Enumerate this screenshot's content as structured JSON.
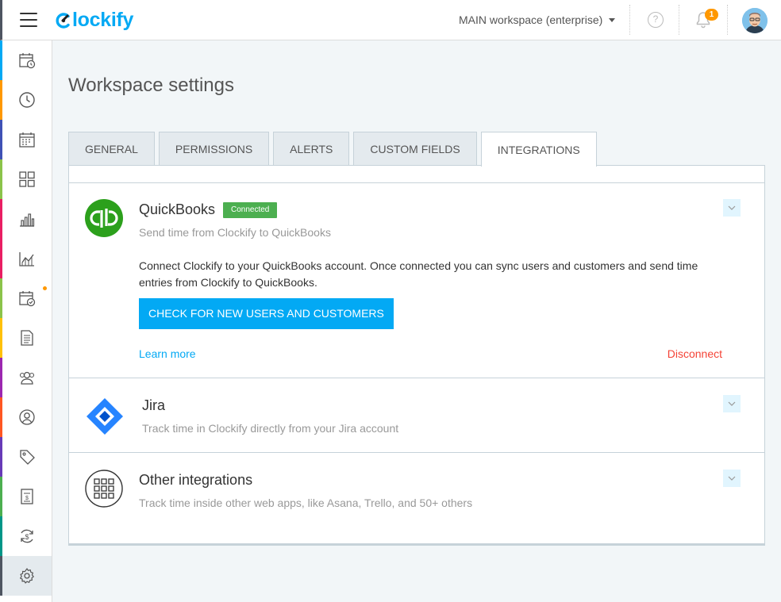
{
  "app": {
    "logo_text": "lockify",
    "brand_color": "#03a9f4"
  },
  "header": {
    "workspace_label": "MAIN workspace (enterprise)",
    "help_icon": "?",
    "notifications_count": "1"
  },
  "sidebar": {
    "items": [
      {
        "name": "timesheet",
        "icon": "calendar-clock-icon",
        "color": "#03a9f4"
      },
      {
        "name": "time-tracker",
        "icon": "clock-icon",
        "color": "#ff9800"
      },
      {
        "name": "calendar",
        "icon": "calendar-icon",
        "color": "#3f51b5"
      },
      {
        "name": "dashboard",
        "icon": "dashboard-grid-icon",
        "color": "#8bc34a"
      },
      {
        "name": "reports",
        "icon": "bar-chart-icon",
        "color": "#e91e63"
      },
      {
        "name": "activity",
        "icon": "area-chart-icon",
        "color": "#e91e63"
      },
      {
        "name": "approvals",
        "icon": "calendar-check-icon",
        "color": "#8bc34a"
      },
      {
        "name": "projects",
        "icon": "document-icon",
        "color": "#ffc107"
      },
      {
        "name": "team",
        "icon": "team-icon",
        "color": "#9c27b0"
      },
      {
        "name": "clients",
        "icon": "person-circle-icon",
        "color": "#ff5722"
      },
      {
        "name": "tags",
        "icon": "tag-icon",
        "color": "#673ab7"
      },
      {
        "name": "invoices",
        "icon": "invoice-icon",
        "color": "#4caf50"
      },
      {
        "name": "expenses",
        "icon": "dollar-sync-icon",
        "color": "#009688"
      },
      {
        "name": "settings",
        "icon": "gear-icon",
        "color": "#4e5561"
      }
    ]
  },
  "page": {
    "title": "Workspace settings"
  },
  "tabs": [
    {
      "label": "GENERAL"
    },
    {
      "label": "PERMISSIONS"
    },
    {
      "label": "ALERTS"
    },
    {
      "label": "CUSTOM FIELDS"
    },
    {
      "label": "INTEGRATIONS"
    }
  ],
  "integrations": {
    "quickbooks": {
      "name": "QuickBooks",
      "status": "Connected",
      "description": "Send time from Clockify to QuickBooks",
      "body": "Connect Clockify to your QuickBooks account. Once connected you can sync users and customers and send time entries from Clockify to QuickBooks.",
      "button": "CHECK FOR NEW USERS AND CUSTOMERS",
      "learn_more": "Learn more",
      "disconnect": "Disconnect"
    },
    "jira": {
      "name": "Jira",
      "description": "Track time in Clockify directly from your Jira account"
    },
    "other": {
      "name": "Other integrations",
      "description": "Track time inside other web apps, like Asana, Trello, and 50+ others"
    }
  }
}
